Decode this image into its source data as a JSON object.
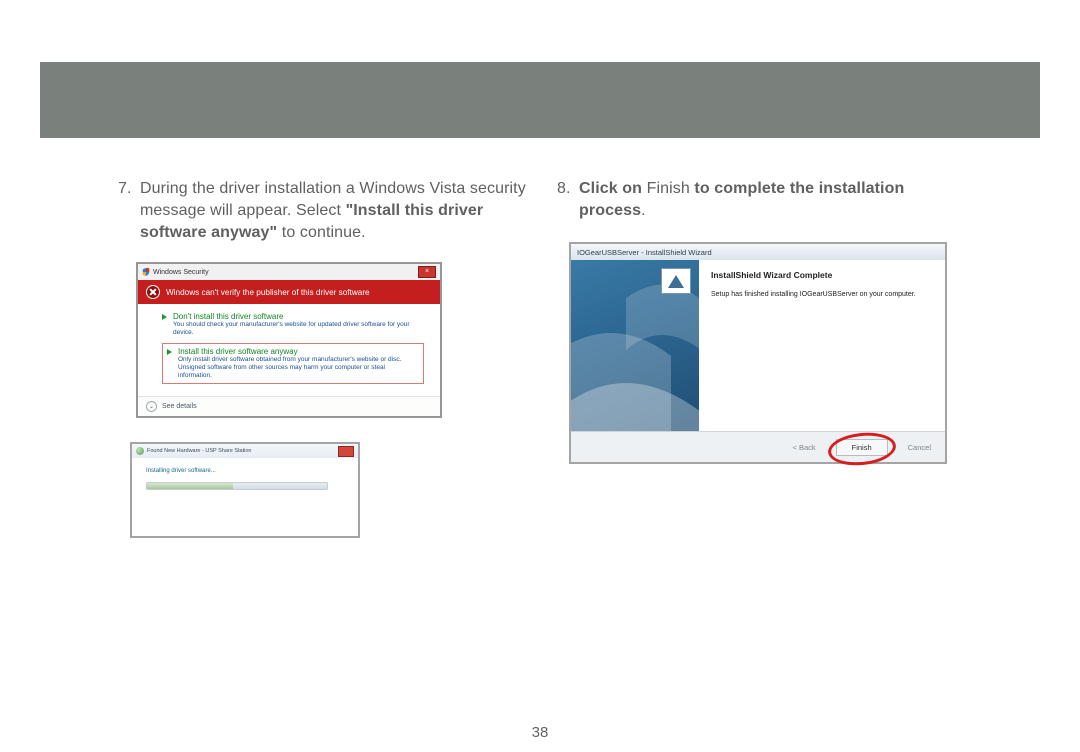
{
  "pageNumber": "38",
  "step7": {
    "num": "7.",
    "pre": "During the driver installation a Windows Vista security message will appear. Select ",
    "bold": "\"Install this driver software anyway\"",
    "post": " to continue."
  },
  "step8": {
    "num": "8.",
    "b1": "Click on ",
    "plain": "Finish ",
    "b2": "to complete the installation process",
    "post": "."
  },
  "securityDialog": {
    "title": "Windows Security",
    "banner": "Windows can't verify the publisher of this driver software",
    "opt1": {
      "title": "Don't install this driver software",
      "desc": "You should check your manufacturer's website for updated driver software for your device."
    },
    "opt2": {
      "title": "Install this driver software anyway",
      "desc": "Only install driver software obtained from your manufacturer's website or disc. Unsigned software from other sources may harm your computer or steal information."
    },
    "seeDetails": "See details"
  },
  "hardwareDialog": {
    "title": "Found New Hardware - USP Share Station",
    "status": "Installing driver software..."
  },
  "wizard": {
    "title": "IOGearUSBServer - InstallShield Wizard",
    "heading": "InstallShield Wizard Complete",
    "desc": "Setup has finished installing IOGearUSBServer on your computer.",
    "back": "< Back",
    "finish": "Finish",
    "cancel": "Cancel"
  }
}
